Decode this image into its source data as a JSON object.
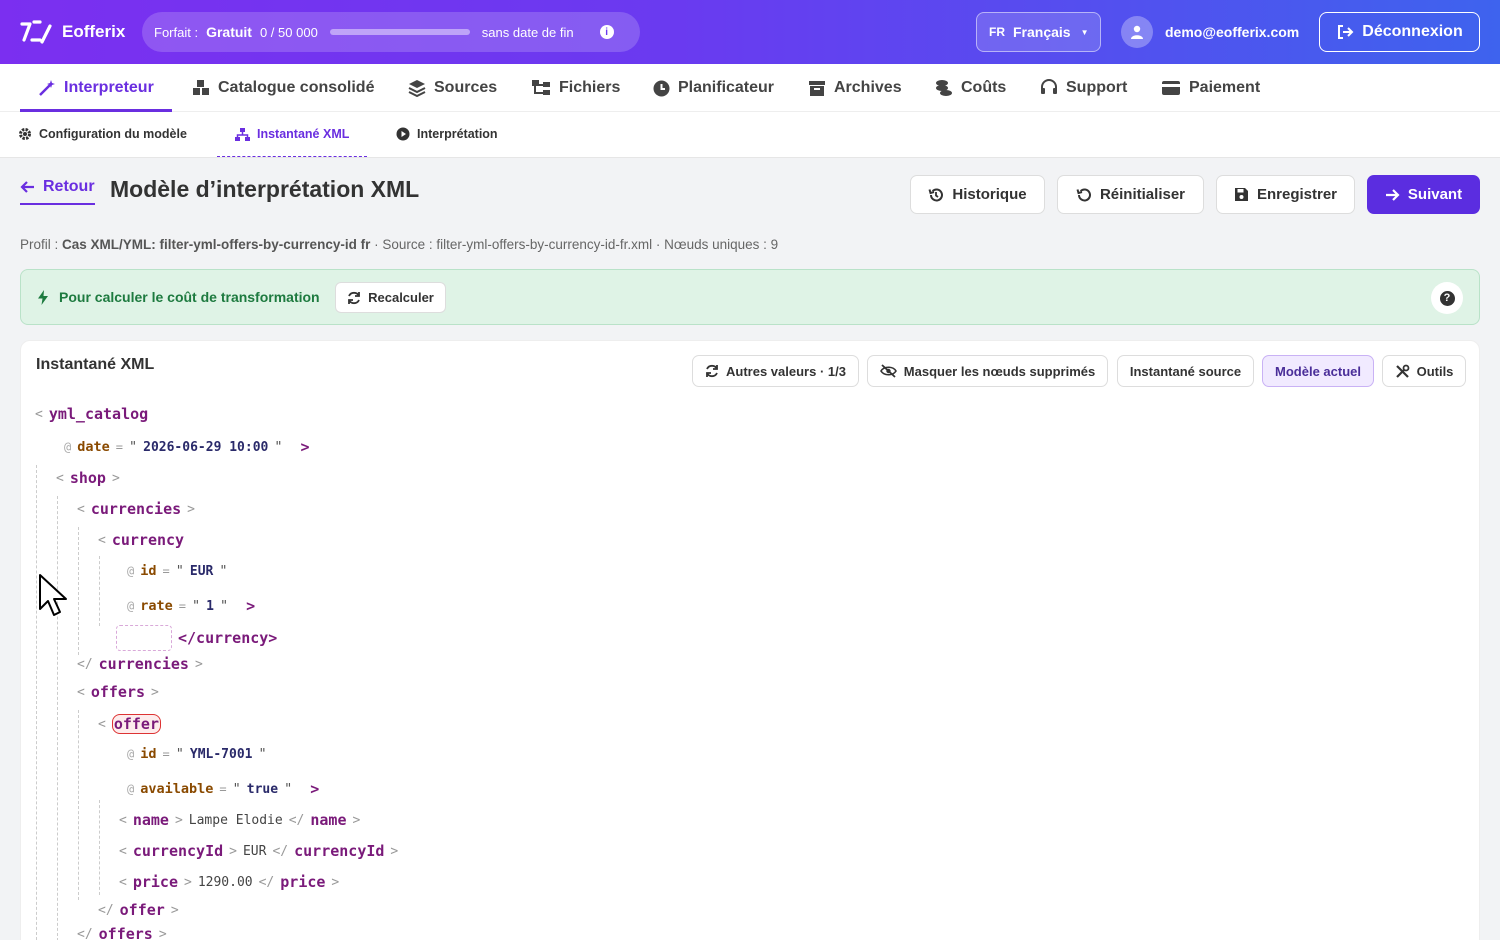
{
  "app": {
    "name": "Eofferix",
    "plan_label": "Forfait :",
    "plan_name": "Gratuit",
    "plan_usage": "0 / 50 000",
    "plan_usage_fraction": 0,
    "plan_end": "sans date de fin",
    "lang_code": "FR",
    "lang_name": "Français",
    "user_email": "demo@eofferix.com",
    "logout_label": "Déconnexion"
  },
  "nav": {
    "items": [
      {
        "label": "Interpreteur",
        "icon": "magic-wand-icon",
        "active": true
      },
      {
        "label": "Catalogue consolidé",
        "icon": "boxes-icon"
      },
      {
        "label": "Sources",
        "icon": "layers-icon"
      },
      {
        "label": "Fichiers",
        "icon": "sitemap-icon"
      },
      {
        "label": "Planificateur",
        "icon": "clock-icon"
      },
      {
        "label": "Archives",
        "icon": "archive-icon"
      },
      {
        "label": "Coûts",
        "icon": "coins-icon"
      },
      {
        "label": "Support",
        "icon": "headset-icon"
      },
      {
        "label": "Paiement",
        "icon": "credit-card-icon"
      }
    ]
  },
  "subnav": {
    "items": [
      {
        "label": "Configuration du modèle",
        "icon": "gear-icon"
      },
      {
        "label": "Instantané XML",
        "icon": "hierarchy-icon",
        "active": true
      },
      {
        "label": "Interprétation",
        "icon": "play-circle-icon"
      }
    ]
  },
  "page": {
    "back_label": "Retour",
    "title": "Modèle d’interprétation XML",
    "buttons": {
      "history": "Historique",
      "reset": "Réinitialiser",
      "save": "Enregistrer",
      "next": "Suivant"
    },
    "meta": {
      "profile_label": "Profil :",
      "profile_value": "Cas XML/YML: filter-yml-offers-by-currency-id fr",
      "source_text": "· Source : filter-yml-offers-by-currency-id-fr.xml · Nœuds uniques : 9"
    },
    "alert": {
      "message": "Pour calculer le coût de transformation",
      "recalc_label": "Recalculer",
      "help": "?"
    }
  },
  "snapshot": {
    "title": "Instantané XML",
    "tools": {
      "other_values": "Autres valeurs · 1/3",
      "hide_deleted": "Masquer les nœuds supprimés",
      "source_snapshot": "Instantané source",
      "current_model": "Modèle actuel",
      "tools": "Outils"
    },
    "xml": {
      "root": "yml_catalog",
      "date_attr": "date",
      "date_val": "2026-06-29 10:00",
      "shop": "shop",
      "currencies": "currencies",
      "currency": "currency",
      "id_attr": "id",
      "currency_id": "EUR",
      "rate_attr": "rate",
      "rate_val": "1",
      "currency_close": "</currency>",
      "currencies_close": "currencies",
      "offers": "offers",
      "offer": "offer",
      "offer_id": "YML-7001",
      "available_attr": "available",
      "available_val": "true",
      "name_tag": "name",
      "name_val": "Lampe Elodie",
      "currencyId_tag": "currencyId",
      "currencyId_val": "EUR",
      "price_tag": "price",
      "price_val": "1290.00",
      "offer_close": "offer",
      "offers_close": "offers"
    }
  }
}
